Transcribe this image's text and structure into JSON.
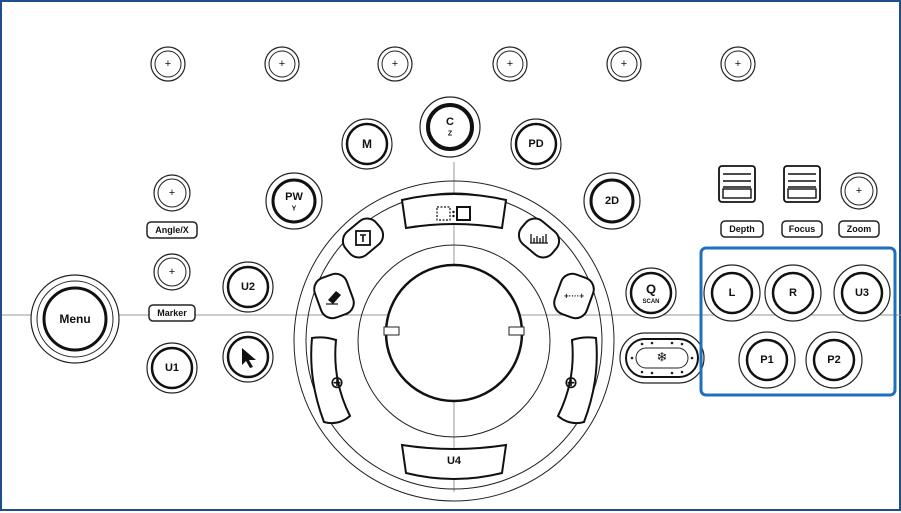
{
  "colors": {
    "frame": "#1f4e8c",
    "highlight": "#1f6fc0",
    "ink": "#222222"
  },
  "top_knobs": [
    "+",
    "+",
    "+",
    "+",
    "+",
    "+"
  ],
  "buttons": {
    "menu": "Menu",
    "u1": "U1",
    "u2": "U2",
    "u3": "U3",
    "u4": "U4",
    "m": "M",
    "c": "C",
    "c_sub": "Z",
    "pd": "PD",
    "pw": "PW",
    "pw_sub": "Y",
    "two_d": "2D",
    "q": "Q",
    "q_sub": "SCAN",
    "l": "L",
    "r": "R",
    "p1": "P1",
    "p2": "P2"
  },
  "labels": {
    "angle": "Angle/X",
    "marker": "Marker",
    "depth": "Depth",
    "focus": "Focus",
    "zoom": "Zoom"
  },
  "icons": {
    "plus": "+",
    "caliper": "+····+",
    "crosshair": "⊕",
    "freeze": "❄"
  }
}
